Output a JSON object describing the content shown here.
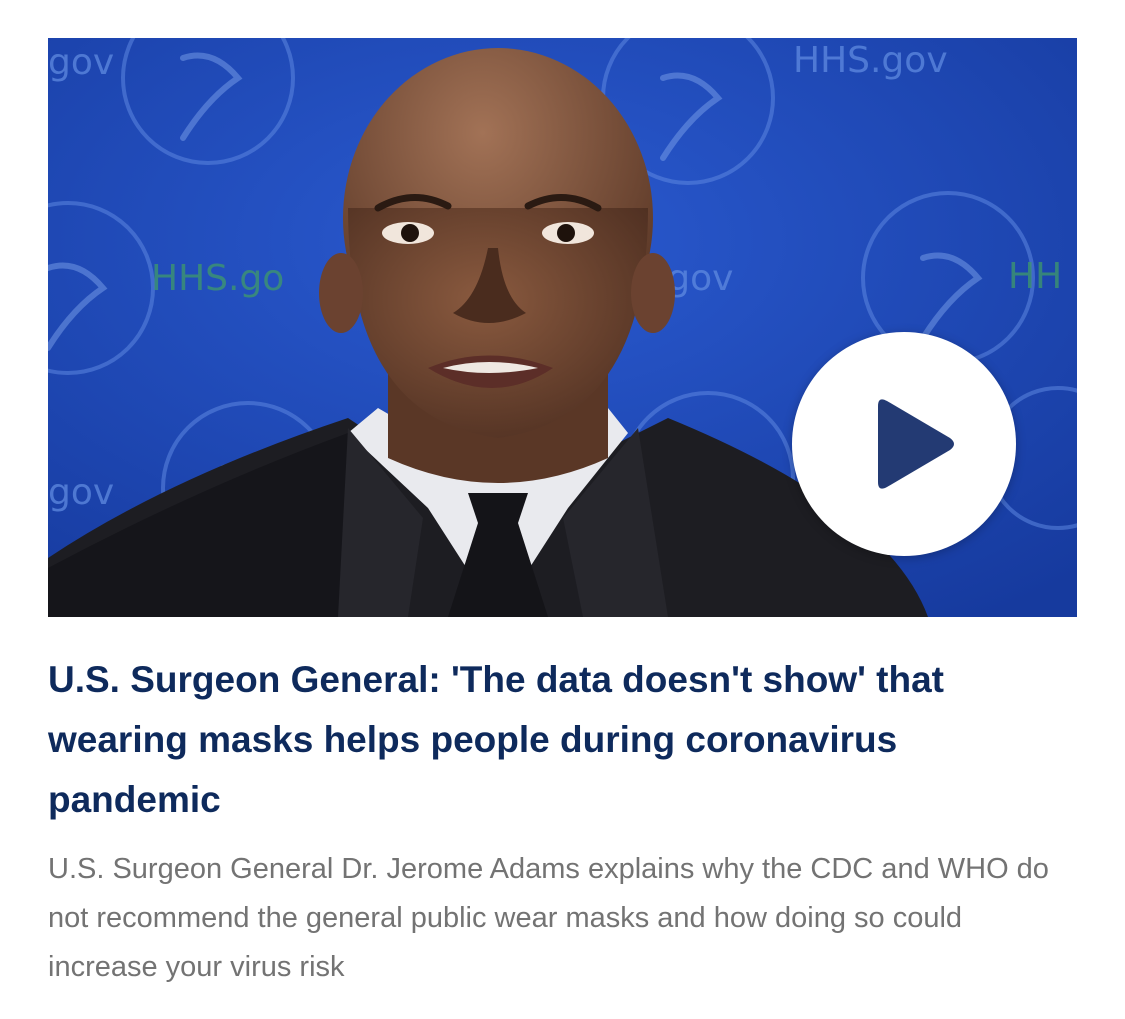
{
  "video": {
    "thumbnail_description": "photo-of-man-in-front-of-blue-backdrop",
    "backdrop_text": [
      "gov",
      "HHS.gov",
      "HHS.go",
      "S.gov",
      "HH",
      "gov",
      "HHS.gov"
    ],
    "play_icon": "play-icon",
    "colors": {
      "backdrop": "#1f46b8",
      "play_button_bg": "#ffffff",
      "play_triangle": "#233a73"
    }
  },
  "article": {
    "headline": "U.S. Surgeon General: 'The data doesn't show' that wearing masks helps people during coronavirus pandemic",
    "summary": "U.S. Surgeon General Dr. Jerome Adams explains why the CDC and WHO do not recommend the general public wear masks and how doing so could increase your virus risk"
  },
  "colors": {
    "headline": "#0e2a5c",
    "summary": "#737373",
    "background": "#ffffff"
  }
}
